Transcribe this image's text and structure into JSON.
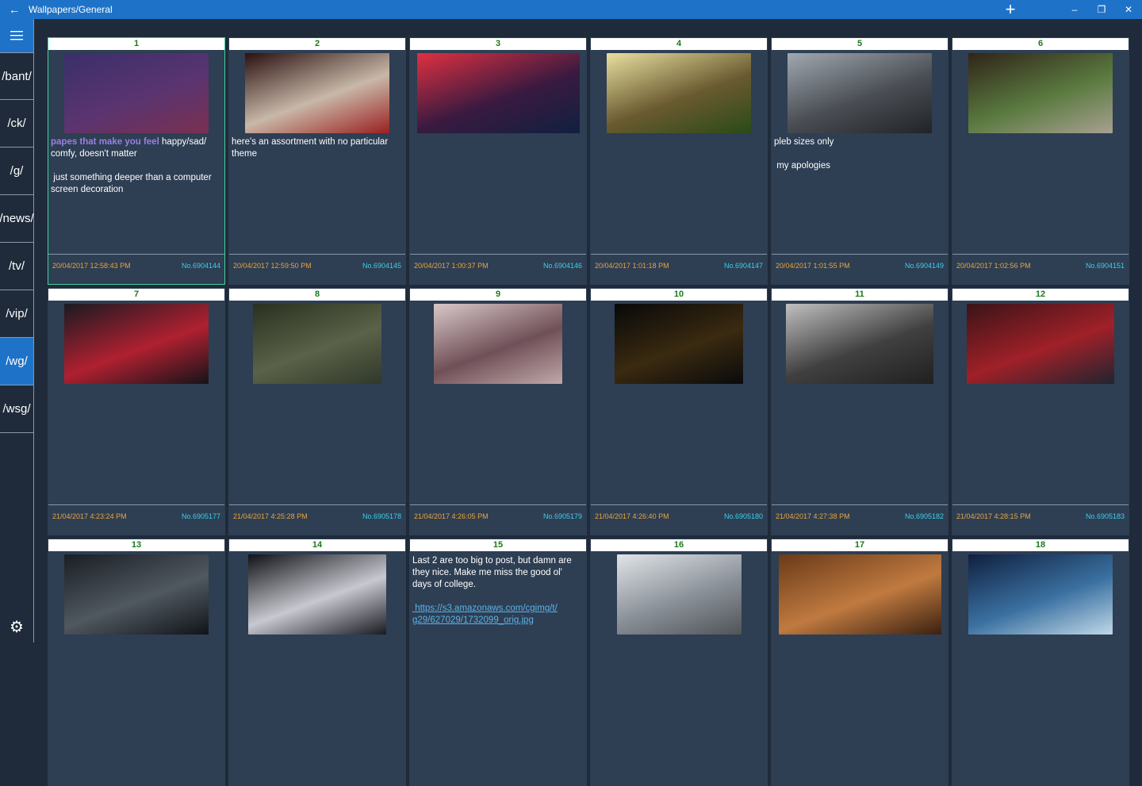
{
  "titlebar": {
    "back_icon": "back-arrow-icon",
    "title": "Wallpapers/General",
    "add_icon": "plus-icon"
  },
  "sidebar": {
    "boards": [
      "/bant/",
      "/ck/",
      "/g/",
      "/news/",
      "/tv/",
      "/vip/",
      "/wg/",
      "/wsg/"
    ],
    "active": "/wg/"
  },
  "colors": {
    "accent": "#1e73c8",
    "card": "#2e3e53",
    "date": "#e8a53a",
    "postno": "#3ad0e8",
    "number": "#1a7a1a",
    "selected_border": "#3fd2a0"
  },
  "threads": [
    {
      "num": "1",
      "highlight": "papes that make you feel",
      "text": " happy/sad/\ncomfy, doesn't matter\n\n just something deeper than a computer\nscreen decoration",
      "date": "20/04/2017 12:58:43 PM",
      "no": "No.6904144",
      "thumb_colors": [
        "#3a2f6a",
        "#5a3470",
        "#7a3050"
      ]
    },
    {
      "num": "2",
      "text": "here's an assortment with no particular\ntheme",
      "date": "20/04/2017 12:59:50 PM",
      "no": "No.6904145",
      "thumb_colors": [
        "#2a1010",
        "#c8b8a8",
        "#9a2020"
      ]
    },
    {
      "num": "3",
      "text": "",
      "date": "20/04/2017 1:00:37 PM",
      "no": "No.6904146",
      "thumb_colors": [
        "#e03040",
        "#3a1a40",
        "#102040"
      ]
    },
    {
      "num": "4",
      "text": "",
      "date": "20/04/2017 1:01:18 PM",
      "no": "No.6904147",
      "thumb_colors": [
        "#e8e0a0",
        "#6a5a30",
        "#2a4a18"
      ]
    },
    {
      "num": "5",
      "text": "pleb sizes only\n\n my apologies",
      "date": "20/04/2017 1:01:55 PM",
      "no": "No.6904149",
      "thumb_colors": [
        "#a0a8b0",
        "#4a4e54",
        "#202428"
      ]
    },
    {
      "num": "6",
      "text": "",
      "date": "20/04/2017 1:02:56 PM",
      "no": "No.6904151",
      "thumb_colors": [
        "#302418",
        "#5a7a40",
        "#a8a090"
      ]
    },
    {
      "num": "7",
      "text": "",
      "date": "21/04/2017 4:23:24 PM",
      "no": "No.6905177",
      "thumb_colors": [
        "#1a1a22",
        "#b02030",
        "#14141a"
      ]
    },
    {
      "num": "8",
      "text": "",
      "date": "21/04/2017 4:25:28 PM",
      "no": "No.6905178",
      "thumb_colors": [
        "#2a3020",
        "#5a6248",
        "#30382a"
      ]
    },
    {
      "num": "9",
      "text": "",
      "date": "21/04/2017 4:26:05 PM",
      "no": "No.6905179",
      "thumb_colors": [
        "#d8c8c8",
        "#705058",
        "#c0a8a8"
      ]
    },
    {
      "num": "10",
      "text": "",
      "date": "21/04/2017 4:26:40 PM",
      "no": "No.6905180",
      "thumb_colors": [
        "#08080a",
        "#3a2a10",
        "#0a0a0c"
      ]
    },
    {
      "num": "11",
      "text": "",
      "date": "21/04/2017 4:27:38 PM",
      "no": "No.6905182",
      "thumb_colors": [
        "#c0c0c0",
        "#404040",
        "#202020"
      ]
    },
    {
      "num": "12",
      "text": "",
      "date": "21/04/2017 4:28:15 PM",
      "no": "No.6905183",
      "thumb_colors": [
        "#3a1418",
        "#a02028",
        "#202430"
      ]
    },
    {
      "num": "13",
      "text": "",
      "date": "",
      "no": "",
      "thumb_colors": [
        "#1a1e24",
        "#505860",
        "#101418"
      ]
    },
    {
      "num": "14",
      "text": "",
      "date": "",
      "no": "",
      "thumb_colors": [
        "#101216",
        "#c8c8d0",
        "#181a20"
      ]
    },
    {
      "num": "15",
      "text": "Last 2 are too big to post, but damn are\nthey nice. Make me miss the good ol'\ndays of college.",
      "link": " https://s3.amazonaws.com/cgimg/t/\ng29/627029/1732099_orig.jpg",
      "date": "",
      "no": "",
      "thumb_colors": []
    },
    {
      "num": "16",
      "text": "",
      "date": "",
      "no": "",
      "thumb_colors": [
        "#e0e4e8",
        "#8a9098",
        "#505458"
      ]
    },
    {
      "num": "17",
      "text": "",
      "date": "",
      "no": "",
      "thumb_colors": [
        "#6a3a18",
        "#c07a40",
        "#3a2010"
      ]
    },
    {
      "num": "18",
      "text": "",
      "date": "",
      "no": "",
      "thumb_colors": [
        "#102040",
        "#3a70a0",
        "#c0d8e8"
      ]
    }
  ]
}
